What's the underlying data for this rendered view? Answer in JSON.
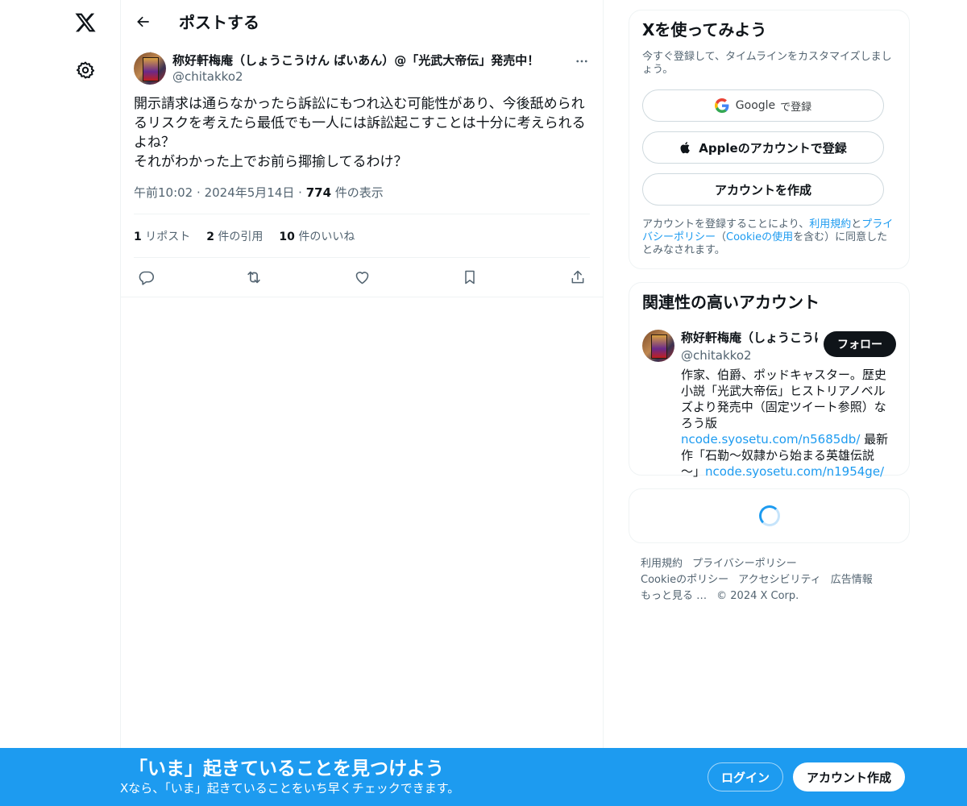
{
  "header": {
    "title": "ポストする"
  },
  "post": {
    "author_name": "称好軒梅庵（しょうこうけん ばいあん）@「光武大帝伝」発売中！",
    "author_handle": "@chitakko2",
    "text": "開示請求は通らなかったら訴訟にもつれ込む可能性があり、今後舐められるリスクを考えたら最低でも一人には訴訟起こすことは十分に考えられるよね？\nそれがわかった上でお前ら揶揄してるわけ？",
    "time": "午前10:02",
    "date": "2024年5月14日",
    "views_count": "774",
    "views_label": " 件の表示",
    "reposts_count": "1",
    "reposts_label": " リポスト",
    "quotes_count": "2",
    "quotes_label": " 件の引用",
    "likes_count": "10",
    "likes_label": " 件のいいね"
  },
  "signup": {
    "title": "Xを使ってみよう",
    "subtitle": "今すぐ登録して、タイムラインをカスタマイズしましょう。",
    "google_label": "Google",
    "google_suffix": "で登録",
    "apple_label": "Appleのアカウントで登録",
    "create_label": "アカウントを作成",
    "terms_pre": "アカウントを登録することにより、",
    "terms_link1": "利用規約",
    "terms_mid1": "と",
    "terms_link2": "プライバシーポリシー",
    "terms_mid2": "（",
    "terms_link3": "Cookieの使用",
    "terms_post": "を含む）に同意したとみなされます。"
  },
  "related": {
    "title": "関連性の高いアカウント",
    "name": "称好軒梅庵（しょうこうけん ばいあん）@「光武大帝伝」発売中！",
    "handle": "@chitakko2",
    "follow_label": "フォロー",
    "bio_1": "作家、伯爵、ポッドキャスター。歴史小説「光武大帝伝」ヒストリアノベルズより発売中（固定ツイート参照）なろう版",
    "bio_link1": "ncode.syosetu.com/n5685db/",
    "bio_2": " 最新作「石勒～奴隷から始まる英雄伝説～」",
    "bio_link2": "ncode.syosetu.com/n1954ge/"
  },
  "footer": {
    "links": [
      "利用規約",
      "プライバシーポリシー",
      "Cookieのポリシー",
      "アクセシビリティ",
      "広告情報",
      "もっと見る …",
      "© 2024 X Corp."
    ]
  },
  "bottombar": {
    "title": "「いま」起きていることを見つけよう",
    "subtitle": "Xなら、「いま」起きていることをいち早くチェックできます。",
    "login_label": "ログイン",
    "create_label": "アカウント作成"
  },
  "colors": {
    "accent": "#1d9bf0",
    "text": "#0f1419",
    "muted": "#536471"
  },
  "icons": [
    "x-logo-icon",
    "gear-icon",
    "back-arrow-icon",
    "more-icon",
    "reply-icon",
    "repost-icon",
    "like-icon",
    "bookmark-icon",
    "share-icon",
    "google-icon",
    "apple-icon",
    "spinner-icon"
  ]
}
